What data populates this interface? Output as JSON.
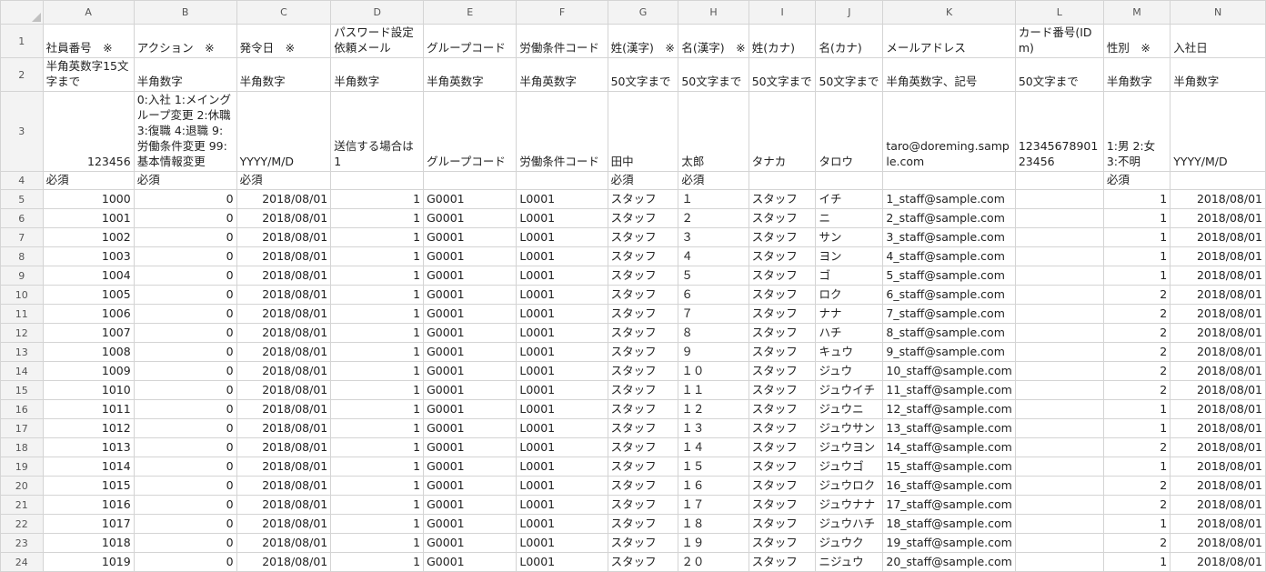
{
  "columns": [
    "A",
    "B",
    "C",
    "D",
    "E",
    "F",
    "G",
    "H",
    "I",
    "J",
    "K",
    "L",
    "M",
    "N"
  ],
  "header_row": [
    "社員番号　※",
    "アクション　※",
    "発令日　※",
    "パスワード設定依頼メール",
    "グループコード",
    "労働条件コード",
    "姓(漢字)　※",
    "名(漢字)　※",
    "姓(カナ)",
    "名(カナ)",
    "メールアドレス",
    "カード番号(IDm)",
    "性別　※",
    "入社日"
  ],
  "format_row": [
    "半角英数字15文字まで",
    "半角数字",
    "半角数字",
    "半角数字",
    "半角英数字",
    "半角英数字",
    "50文字まで",
    "50文字まで",
    "50文字まで",
    "50文字まで",
    "半角英数字、記号",
    "50文字まで",
    "半角数字",
    "半角数字"
  ],
  "example_row": [
    "123456",
    "0:入社 1:メイングループ変更 2:休職 3:復職 4:退職 9:労働条件変更 99:基本情報変更",
    "YYYY/M/D",
    "送信する場合は1",
    "グループコード",
    "労働条件コード",
    "田中",
    "太郎",
    "タナカ",
    "タロウ",
    "taro@doreming.sample.com",
    "1234567890123456",
    "1:男 2:女 3:不明",
    "YYYY/M/D"
  ],
  "required_row": [
    "必須",
    "必須",
    "必須",
    "",
    "",
    "",
    "必須",
    "必須",
    "",
    "",
    "",
    "",
    "必須",
    ""
  ],
  "data_rows": [
    [
      "1000",
      "0",
      "2018/08/01",
      "1",
      "G0001",
      "L0001",
      "スタッフ",
      "１",
      "スタッフ",
      "イチ",
      "1_staff@sample.com",
      "",
      "1",
      "2018/08/01"
    ],
    [
      "1001",
      "0",
      "2018/08/01",
      "1",
      "G0001",
      "L0001",
      "スタッフ",
      "２",
      "スタッフ",
      "ニ",
      "2_staff@sample.com",
      "",
      "1",
      "2018/08/01"
    ],
    [
      "1002",
      "0",
      "2018/08/01",
      "1",
      "G0001",
      "L0001",
      "スタッフ",
      "３",
      "スタッフ",
      "サン",
      "3_staff@sample.com",
      "",
      "1",
      "2018/08/01"
    ],
    [
      "1003",
      "0",
      "2018/08/01",
      "1",
      "G0001",
      "L0001",
      "スタッフ",
      "４",
      "スタッフ",
      "ヨン",
      "4_staff@sample.com",
      "",
      "1",
      "2018/08/01"
    ],
    [
      "1004",
      "0",
      "2018/08/01",
      "1",
      "G0001",
      "L0001",
      "スタッフ",
      "５",
      "スタッフ",
      "ゴ",
      "5_staff@sample.com",
      "",
      "1",
      "2018/08/01"
    ],
    [
      "1005",
      "0",
      "2018/08/01",
      "1",
      "G0001",
      "L0001",
      "スタッフ",
      "６",
      "スタッフ",
      "ロク",
      "6_staff@sample.com",
      "",
      "2",
      "2018/08/01"
    ],
    [
      "1006",
      "0",
      "2018/08/01",
      "1",
      "G0001",
      "L0001",
      "スタッフ",
      "７",
      "スタッフ",
      "ナナ",
      "7_staff@sample.com",
      "",
      "2",
      "2018/08/01"
    ],
    [
      "1007",
      "0",
      "2018/08/01",
      "1",
      "G0001",
      "L0001",
      "スタッフ",
      "８",
      "スタッフ",
      "ハチ",
      "8_staff@sample.com",
      "",
      "2",
      "2018/08/01"
    ],
    [
      "1008",
      "0",
      "2018/08/01",
      "1",
      "G0001",
      "L0001",
      "スタッフ",
      "９",
      "スタッフ",
      "キュウ",
      "9_staff@sample.com",
      "",
      "2",
      "2018/08/01"
    ],
    [
      "1009",
      "0",
      "2018/08/01",
      "1",
      "G0001",
      "L0001",
      "スタッフ",
      "１０",
      "スタッフ",
      "ジュウ",
      "10_staff@sample.com",
      "",
      "2",
      "2018/08/01"
    ],
    [
      "1010",
      "0",
      "2018/08/01",
      "1",
      "G0001",
      "L0001",
      "スタッフ",
      "１１",
      "スタッフ",
      "ジュウイチ",
      "11_staff@sample.com",
      "",
      "2",
      "2018/08/01"
    ],
    [
      "1011",
      "0",
      "2018/08/01",
      "1",
      "G0001",
      "L0001",
      "スタッフ",
      "１２",
      "スタッフ",
      "ジュウニ",
      "12_staff@sample.com",
      "",
      "1",
      "2018/08/01"
    ],
    [
      "1012",
      "0",
      "2018/08/01",
      "1",
      "G0001",
      "L0001",
      "スタッフ",
      "１３",
      "スタッフ",
      "ジュウサン",
      "13_staff@sample.com",
      "",
      "1",
      "2018/08/01"
    ],
    [
      "1013",
      "0",
      "2018/08/01",
      "1",
      "G0001",
      "L0001",
      "スタッフ",
      "１４",
      "スタッフ",
      "ジュウヨン",
      "14_staff@sample.com",
      "",
      "2",
      "2018/08/01"
    ],
    [
      "1014",
      "0",
      "2018/08/01",
      "1",
      "G0001",
      "L0001",
      "スタッフ",
      "１５",
      "スタッフ",
      "ジュウゴ",
      "15_staff@sample.com",
      "",
      "1",
      "2018/08/01"
    ],
    [
      "1015",
      "0",
      "2018/08/01",
      "1",
      "G0001",
      "L0001",
      "スタッフ",
      "１６",
      "スタッフ",
      "ジュウロク",
      "16_staff@sample.com",
      "",
      "2",
      "2018/08/01"
    ],
    [
      "1016",
      "0",
      "2018/08/01",
      "1",
      "G0001",
      "L0001",
      "スタッフ",
      "１７",
      "スタッフ",
      "ジュウナナ",
      "17_staff@sample.com",
      "",
      "2",
      "2018/08/01"
    ],
    [
      "1017",
      "0",
      "2018/08/01",
      "1",
      "G0001",
      "L0001",
      "スタッフ",
      "１８",
      "スタッフ",
      "ジュウハチ",
      "18_staff@sample.com",
      "",
      "1",
      "2018/08/01"
    ],
    [
      "1018",
      "0",
      "2018/08/01",
      "1",
      "G0001",
      "L0001",
      "スタッフ",
      "１９",
      "スタッフ",
      "ジュウク",
      "19_staff@sample.com",
      "",
      "2",
      "2018/08/01"
    ],
    [
      "1019",
      "0",
      "2018/08/01",
      "1",
      "G0001",
      "L0001",
      "スタッフ",
      "２０",
      "スタッフ",
      "ニジュウ",
      "20_staff@sample.com",
      "",
      "1",
      "2018/08/01"
    ]
  ]
}
